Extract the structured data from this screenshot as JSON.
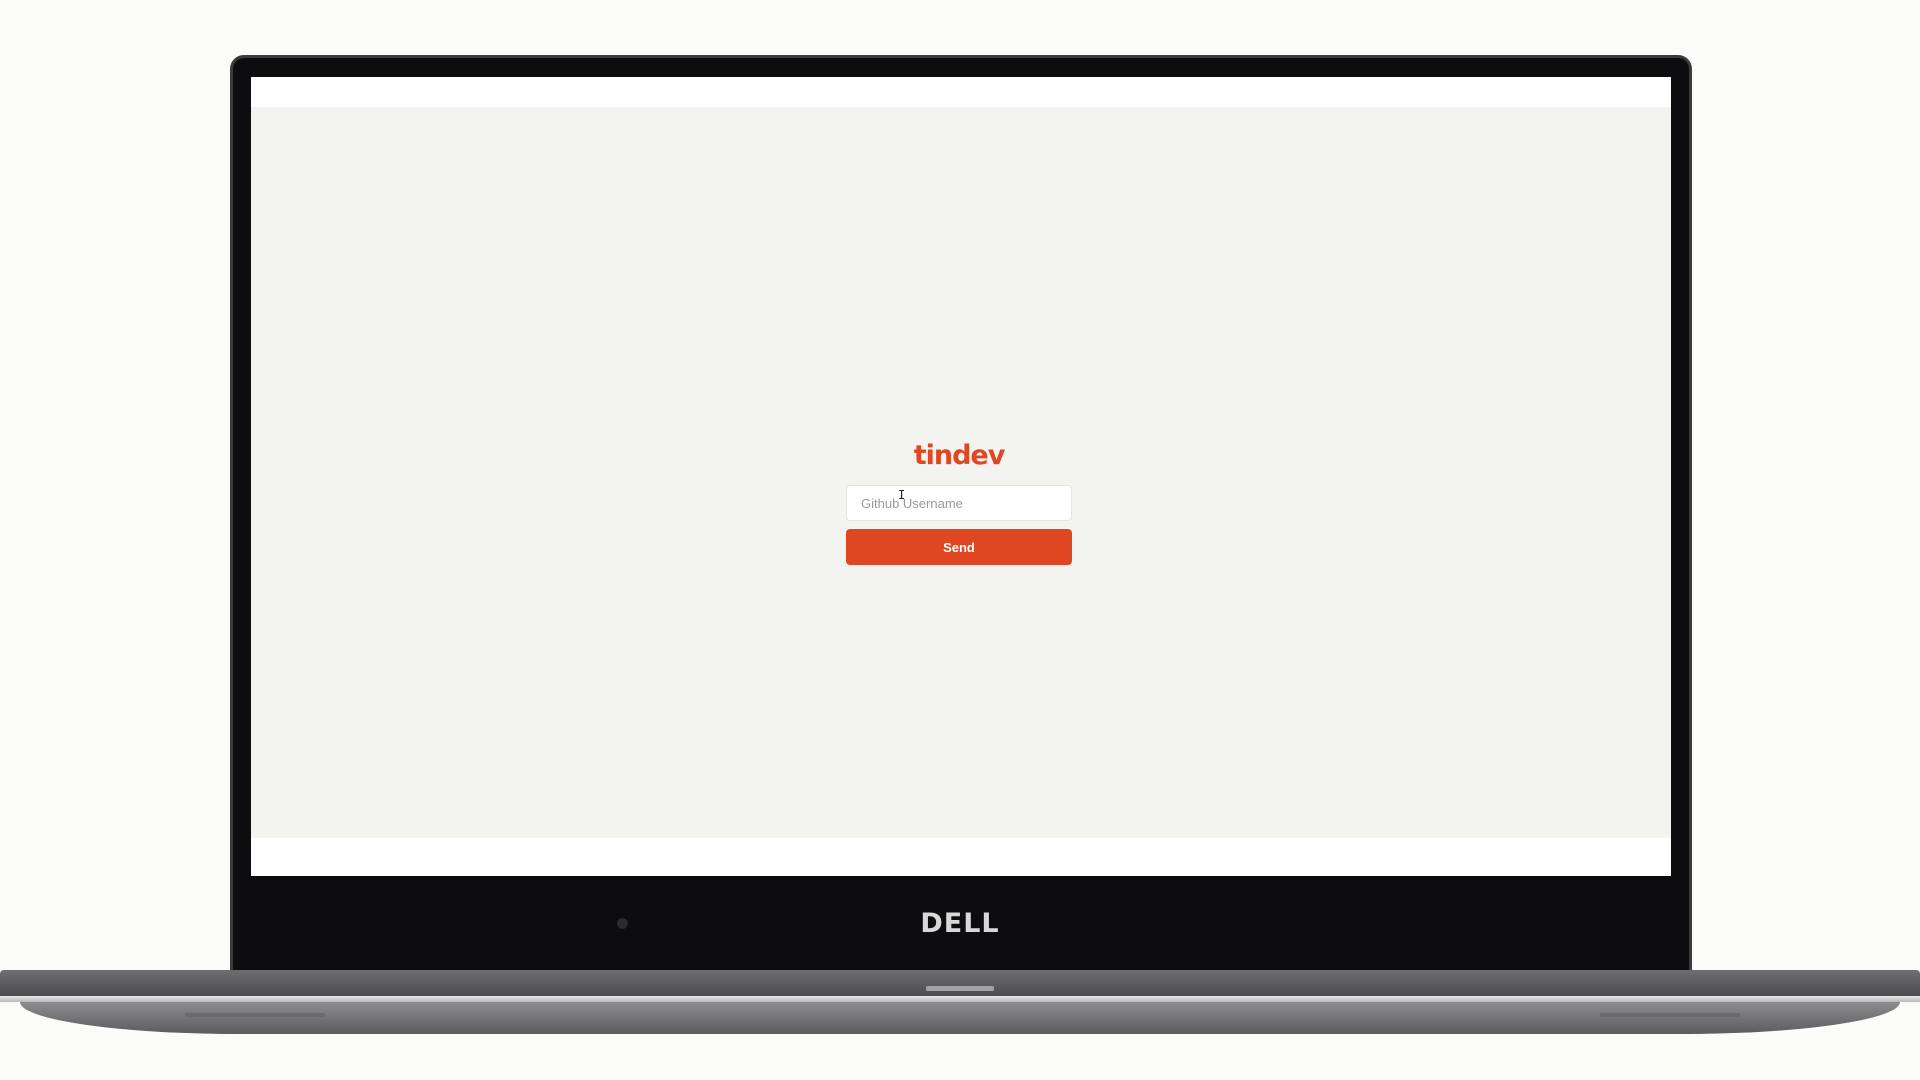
{
  "app": {
    "logo_text": "tindev",
    "brand_color": "#df4723",
    "background_color": "#f3f3f0"
  },
  "login": {
    "username_placeholder": "Github Username",
    "username_value": "",
    "send_label": "Send"
  },
  "device": {
    "brand_label": "DELL"
  },
  "icons": {
    "cursor": "text-cursor-icon",
    "camera": "webcam-icon"
  }
}
